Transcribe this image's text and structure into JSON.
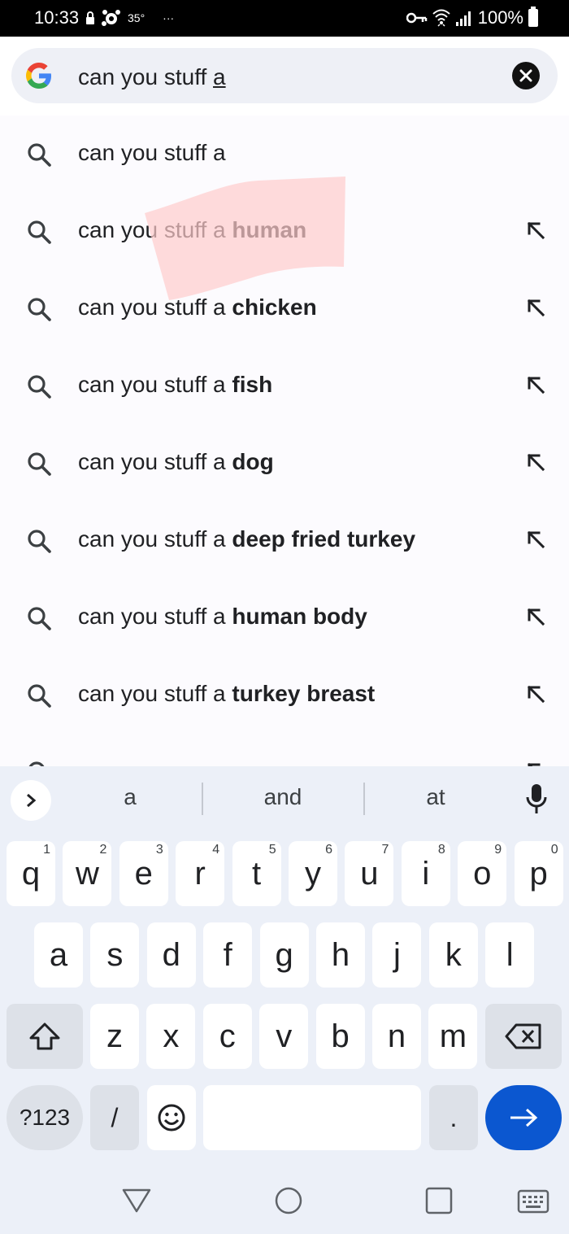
{
  "status_bar": {
    "time": "10:33",
    "temperature": "35°",
    "overflow": "···",
    "battery": "100%",
    "icons": [
      "lock-icon",
      "avast-icon",
      "vpn-key-icon",
      "wifi-icon",
      "signal-icon",
      "battery-icon"
    ]
  },
  "search": {
    "query_prefix": "can you stuff ",
    "query_cursor_word": "a",
    "clear_icon": "close-icon"
  },
  "suggestions": [
    {
      "prefix": "can you stuff a",
      "bold": ""
    },
    {
      "prefix": "can you stuff a ",
      "bold": "human"
    },
    {
      "prefix": "can you stuff a ",
      "bold": "chicken"
    },
    {
      "prefix": "can you stuff a ",
      "bold": "fish"
    },
    {
      "prefix": "can you stuff a ",
      "bold": "dog"
    },
    {
      "prefix": "can you stuff a ",
      "bold": "deep fried turkey"
    },
    {
      "prefix": "can you stuff a ",
      "bold": "human body"
    },
    {
      "prefix": "can you stuff a ",
      "bold": "turkey breast"
    }
  ],
  "keyboard": {
    "word_suggestions": [
      "a",
      "and",
      "at"
    ],
    "row1": [
      "q",
      "w",
      "e",
      "r",
      "t",
      "y",
      "u",
      "i",
      "o",
      "p"
    ],
    "row1_numbers": [
      "1",
      "2",
      "3",
      "4",
      "5",
      "6",
      "7",
      "8",
      "9",
      "0"
    ],
    "row2": [
      "a",
      "s",
      "d",
      "f",
      "g",
      "h",
      "j",
      "k",
      "l"
    ],
    "row3": [
      "z",
      "x",
      "c",
      "v",
      "b",
      "n",
      "m"
    ],
    "symbols_label": "?123",
    "slash_label": "/",
    "period_label": "."
  },
  "colors": {
    "accent_blue": "#0b57d0",
    "highlight_pink": "#ffcccc",
    "keyboard_bg": "#ecf0f8"
  }
}
